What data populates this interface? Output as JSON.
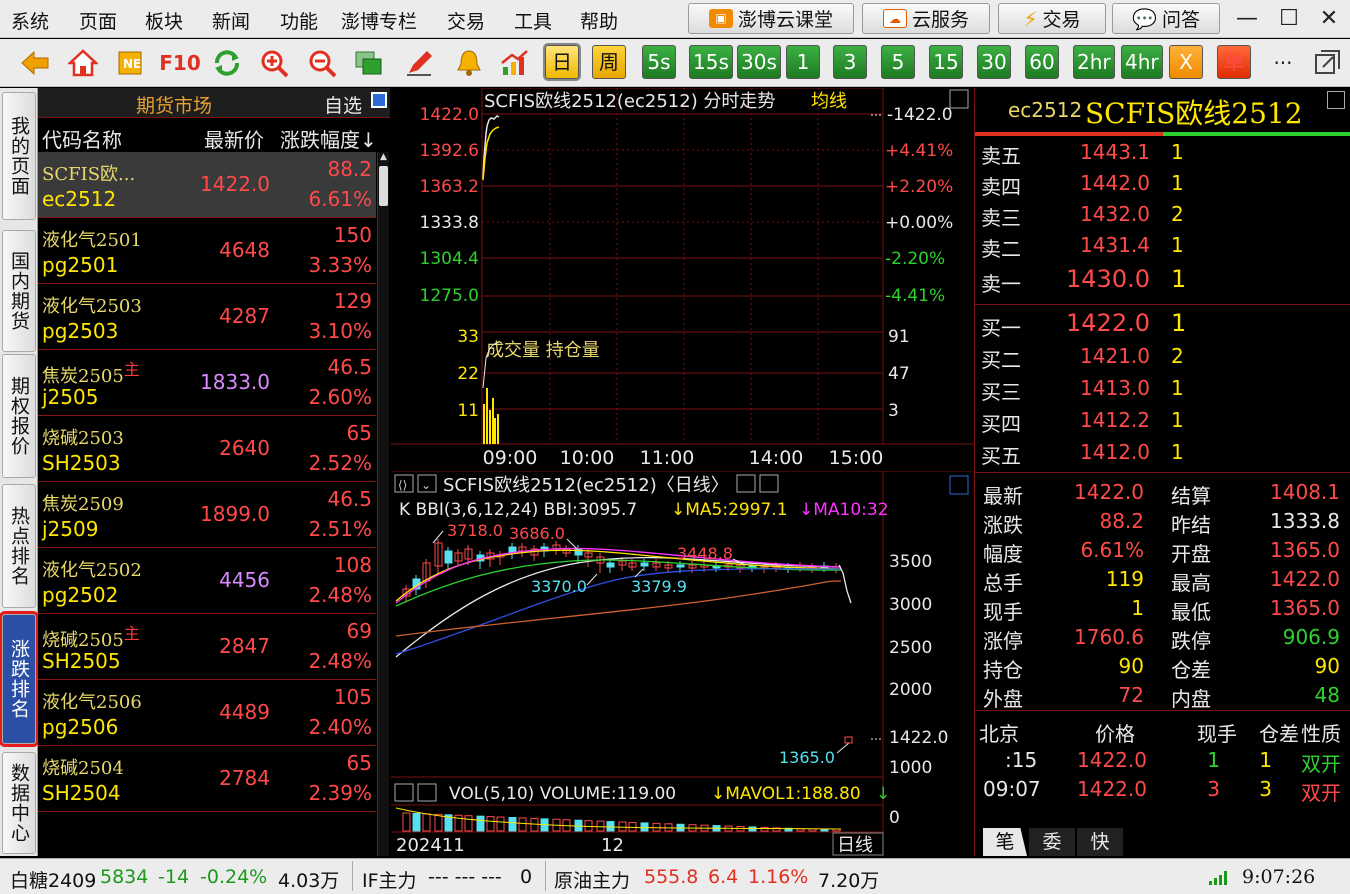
{
  "menu": [
    "系统",
    "页面",
    "板块",
    "新闻",
    "功能",
    "澎博专栏",
    "交易",
    "工具",
    "帮助"
  ],
  "top_buttons": {
    "classroom": "澎博云课堂",
    "cloud": "云服务",
    "trade": "交易",
    "qa": "问答"
  },
  "toolbar": {
    "f10": "F10",
    "periods": [
      "日",
      "周",
      "5s",
      "15s",
      "30s",
      "1",
      "3",
      "5",
      "15",
      "30",
      "60",
      "2hr",
      "4hr",
      "X",
      "单"
    ],
    "more": "···"
  },
  "left_tabs": [
    "我的页面",
    "国内期货",
    "期权报价",
    "热点排名",
    "涨跌排名",
    "数据中心"
  ],
  "quote_list": {
    "market_title": "期货市场",
    "watchlist_label": "自选",
    "headers": {
      "name": "代码名称",
      "last": "最新价",
      "change_pct": "涨跌幅度↓"
    },
    "rows": [
      {
        "name": "SCFIS欧...",
        "code": "ec2512",
        "last": "1422.0",
        "change": "88.2",
        "pct": "6.61%",
        "tag": ""
      },
      {
        "name": "液化气2501",
        "code": "pg2501",
        "last": "4648",
        "change": "150",
        "pct": "3.33%",
        "tag": ""
      },
      {
        "name": "液化气2503",
        "code": "pg2503",
        "last": "4287",
        "change": "129",
        "pct": "3.10%",
        "tag": ""
      },
      {
        "name": "焦炭2505",
        "code": "j2505",
        "last": "1833.0",
        "change": "46.5",
        "pct": "2.60%",
        "tag": "主"
      },
      {
        "name": "烧碱2503",
        "code": "SH2503",
        "last": "2640",
        "change": "65",
        "pct": "2.52%",
        "tag": ""
      },
      {
        "name": "焦炭2509",
        "code": "j2509",
        "last": "1899.0",
        "change": "46.5",
        "pct": "2.51%",
        "tag": ""
      },
      {
        "name": "液化气2502",
        "code": "pg2502",
        "last": "4456",
        "change": "108",
        "pct": "2.48%",
        "tag": ""
      },
      {
        "name": "烧碱2505",
        "code": "SH2505",
        "last": "2847",
        "change": "69",
        "pct": "2.48%",
        "tag": "主"
      },
      {
        "name": "液化气2506",
        "code": "pg2506",
        "last": "4489",
        "change": "105",
        "pct": "2.40%",
        "tag": ""
      },
      {
        "name": "烧碱2504",
        "code": "SH2504",
        "last": "2784",
        "change": "65",
        "pct": "2.39%",
        "tag": ""
      }
    ]
  },
  "intraday": {
    "title": "SCFIS欧线2512(ec2512) 分时走势",
    "avg_label": "均线",
    "price_ticks": [
      "1422.0",
      "1392.6",
      "1363.2",
      "1333.8",
      "1304.4",
      "1275.0"
    ],
    "pct_ticks": [
      "-1422.0",
      "+4.41%",
      "+2.20%",
      "+0.00%",
      "-2.20%",
      "-4.41%"
    ],
    "vol_label": "成交量 持仓量",
    "vol_ticks_left": [
      "33",
      "22",
      "11"
    ],
    "vol_ticks_right": [
      "91",
      "47",
      "3"
    ],
    "time_ticks": [
      "09:00",
      "10:00",
      "11:00",
      "14:00",
      "15:00"
    ]
  },
  "kline": {
    "title": "SCFIS欧线2512(ec2512)〈日线〉",
    "indicator": "K BBI(3,6,12,24) BBI:3095.7",
    "ma5": "↓MA5:2997.1",
    "ma10": "↓MA10:32",
    "annotations": [
      "3718.0",
      "3686.0",
      "3448.8",
      "3370.0",
      "3379.9",
      "1365.0"
    ],
    "y_ticks": [
      "3500",
      "3000",
      "2500",
      "2000",
      "1000"
    ],
    "last_tick": "1422.0",
    "vol_indicator": "VOL(5,10) VOLUME:119.00",
    "mavol": "↓MAVOL1:188.80",
    "mavol_arrow": "↓",
    "vol_zero": "0",
    "x_labels": [
      "202411",
      "12"
    ],
    "period_label": "日线"
  },
  "order_book": {
    "code": "ec2512",
    "name": "SCFIS欧线2512",
    "asks": [
      {
        "label": "卖五",
        "price": "1443.1",
        "qty": "1"
      },
      {
        "label": "卖四",
        "price": "1442.0",
        "qty": "1"
      },
      {
        "label": "卖三",
        "price": "1432.0",
        "qty": "2"
      },
      {
        "label": "卖二",
        "price": "1431.4",
        "qty": "1"
      },
      {
        "label": "卖一",
        "price": "1430.0",
        "qty": "1"
      }
    ],
    "bids": [
      {
        "label": "买一",
        "price": "1422.0",
        "qty": "1"
      },
      {
        "label": "买二",
        "price": "1421.0",
        "qty": "2"
      },
      {
        "label": "买三",
        "price": "1413.0",
        "qty": "1"
      },
      {
        "label": "买四",
        "price": "1412.2",
        "qty": "1"
      },
      {
        "label": "买五",
        "price": "1412.0",
        "qty": "1"
      }
    ]
  },
  "stats": [
    {
      "l1": "最新",
      "v1": "1422.0",
      "c1": "red",
      "l2": "结算",
      "v2": "1408.1",
      "c2": "red"
    },
    {
      "l1": "涨跌",
      "v1": "88.2",
      "c1": "red",
      "l2": "昨结",
      "v2": "1333.8",
      "c2": "wht"
    },
    {
      "l1": "幅度",
      "v1": "6.61%",
      "c1": "red",
      "l2": "开盘",
      "v2": "1365.0",
      "c2": "red"
    },
    {
      "l1": "总手",
      "v1": "119",
      "c1": "yel",
      "l2": "最高",
      "v2": "1422.0",
      "c2": "red"
    },
    {
      "l1": "现手",
      "v1": "1",
      "c1": "yel",
      "l2": "最低",
      "v2": "1365.0",
      "c2": "red"
    },
    {
      "l1": "涨停",
      "v1": "1760.6",
      "c1": "red",
      "l2": "跌停",
      "v2": "906.9",
      "c2": "grn"
    },
    {
      "l1": "持仓",
      "v1": "90",
      "c1": "yel",
      "l2": "仓差",
      "v2": "90",
      "c2": "yel"
    },
    {
      "l1": "外盘",
      "v1": "72",
      "c1": "red",
      "l2": "内盘",
      "v2": "48",
      "c2": "grn"
    }
  ],
  "ticks": {
    "headers": [
      "北京",
      "价格",
      "现手",
      "仓差",
      "性质"
    ],
    "rows": [
      {
        "time": ":15",
        "price": "1422.0",
        "qty": "1",
        "oi": "1",
        "nature": "双开",
        "qc": "grn",
        "nc": "grn"
      },
      {
        "time": "09:07",
        "price": "1422.0",
        "qty": "3",
        "oi": "3",
        "nature": "双开",
        "qc": "red",
        "nc": "red"
      }
    ],
    "tabs": [
      "笔",
      "委",
      "快"
    ]
  },
  "statusbar": {
    "s1_name": "白糖2409",
    "s1_price": "5834",
    "s1_chg": "-14",
    "s1_pct": "-0.24%",
    "s1_vol": "4.03万",
    "s2_name": "IF主力",
    "s2_vals": "--- --- ---",
    "s2_vol": "0",
    "s3_name": "原油主力",
    "s3_price": "555.8",
    "s3_chg": "6.4",
    "s3_pct": "1.16%",
    "s3_vol": "7.20万",
    "clock": "9:07:26"
  }
}
